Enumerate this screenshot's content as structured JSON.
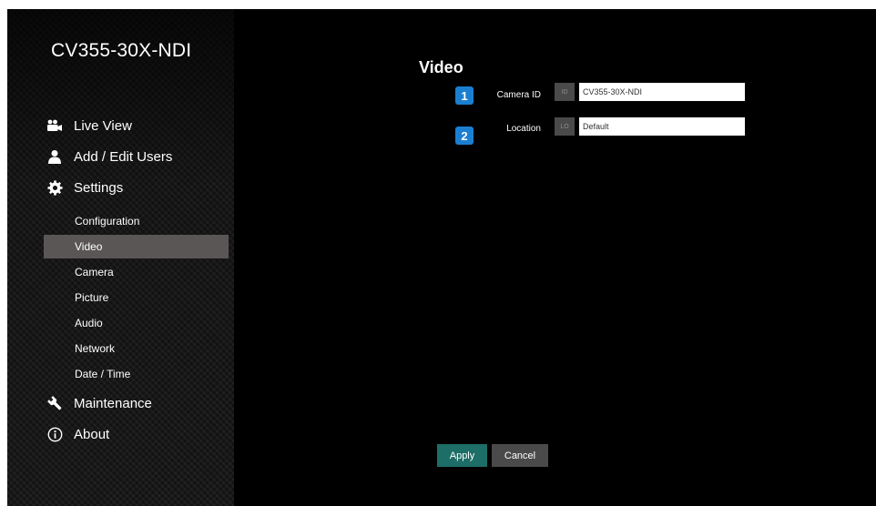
{
  "app": {
    "model_name": "CV355-30X-NDI"
  },
  "sidebar": {
    "main_items": [
      {
        "label": "Live View",
        "icon": "video-camera-icon"
      },
      {
        "label": "Add / Edit Users",
        "icon": "user-icon"
      },
      {
        "label": "Settings",
        "icon": "gear-icon"
      }
    ],
    "settings_items": [
      {
        "label": "Configuration",
        "active": false
      },
      {
        "label": "Video",
        "active": true
      },
      {
        "label": "Camera",
        "active": false
      },
      {
        "label": "Picture",
        "active": false
      },
      {
        "label": "Audio",
        "active": false
      },
      {
        "label": "Network",
        "active": false
      },
      {
        "label": "Date / Time",
        "active": false
      }
    ],
    "bottom_items": [
      {
        "label": "Maintenance",
        "icon": "wrench-icon"
      },
      {
        "label": "About",
        "icon": "info-icon"
      }
    ]
  },
  "main": {
    "title": "Video",
    "fields": [
      {
        "badge": "1",
        "label": "Camera ID",
        "value": "CV355-30X-NDI"
      },
      {
        "badge": "2",
        "label": "Location",
        "value": "Default"
      }
    ],
    "apply_label": "Apply",
    "cancel_label": "Cancel"
  },
  "colors": {
    "background": "#000000",
    "active_item": "#5a5656",
    "badge": "#1b7fd1",
    "apply_button": "#1d6e66",
    "cancel_button": "#4a4a4a"
  }
}
